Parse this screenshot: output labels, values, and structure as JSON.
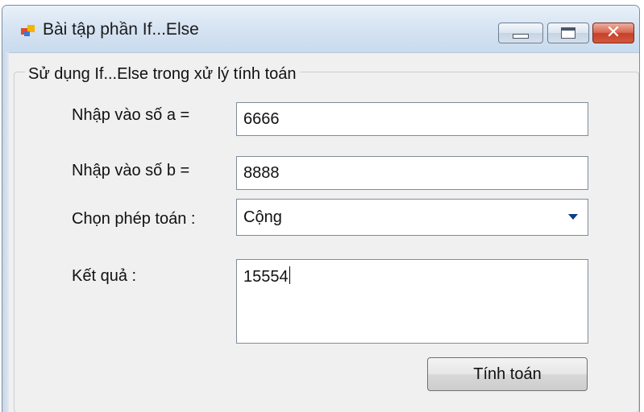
{
  "window": {
    "title": "Bài tập phần If...Else",
    "controls": {
      "minimize": "minimize",
      "maximize": "maximize",
      "close": "✕"
    }
  },
  "group": {
    "legend": "Sử dụng If...Else trong xử lý tính toán"
  },
  "form": {
    "a_label": "Nhập vào số a =",
    "a_value": "6666",
    "b_label": "Nhập vào số b =",
    "b_value": "8888",
    "op_label": "Chọn phép toán :",
    "op_value": "Cộng",
    "result_label": "Kết quả :",
    "result_value": "15554",
    "calc_button": "Tính toán"
  },
  "icons": {
    "app": "app-window-icon",
    "dropdown": "chevron-down-icon"
  },
  "colors": {
    "titlebar": "#d7e4f2",
    "close_button": "#c4412b",
    "dropdown_arrow": "#0d3d85"
  }
}
